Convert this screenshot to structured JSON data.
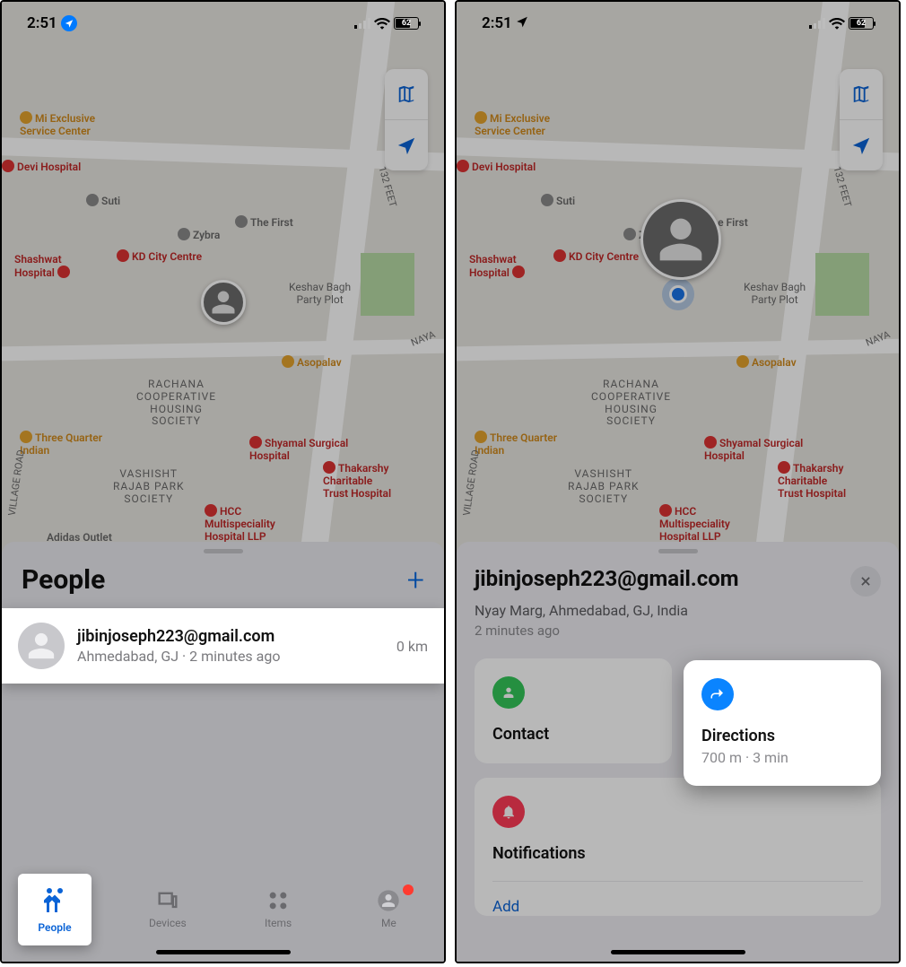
{
  "status": {
    "time": "2:51",
    "battery": "62"
  },
  "map": {
    "pois": {
      "mi": "Mi Exclusive\nService Center",
      "devi": "Devi Hospital",
      "suti": "Suti",
      "zybra": "Zybra",
      "first": "The First",
      "kd": "KD City Centre",
      "shashwat": "Shashwat\nHospital",
      "keshav": "Keshav Bagh\nParty Plot",
      "asopalav": "Asopalav",
      "rachana": "RACHANA\nCOOPERATIVE\nHOUSING\nSOCIETY",
      "tq": "Three Quarter\nIndian",
      "shyamal": "Shyamal Surgical\nHospital",
      "thakarshy": "Thakarshy\nCharitable\nTrust Hospital",
      "vashisht": "VASHISHT\nRAJAB PARK\nSOCIETY",
      "hcc": "HCC\nMultispeciality\nHospital LLP",
      "road132": "132 FEET",
      "naya": "NAYA",
      "village": "VILLAGE ROAD",
      "adidas": "Adidas Outlet"
    }
  },
  "left": {
    "sheet_title": "People",
    "person": {
      "name": "jibinjoseph223@gmail.com",
      "subtitle": "Ahmedabad, GJ · 2 minutes ago",
      "distance": "0 km"
    },
    "tabs": {
      "people": "People",
      "devices": "Devices",
      "items": "Items",
      "me": "Me"
    }
  },
  "right": {
    "title": "jibinjoseph223@gmail.com",
    "address": "Nyay Marg, Ahmedabad, GJ, India",
    "timeago": "2 minutes ago",
    "contact": "Contact",
    "directions": {
      "title": "Directions",
      "sub": "700 m · 3 min"
    },
    "notifications": "Notifications",
    "add": "Add"
  }
}
